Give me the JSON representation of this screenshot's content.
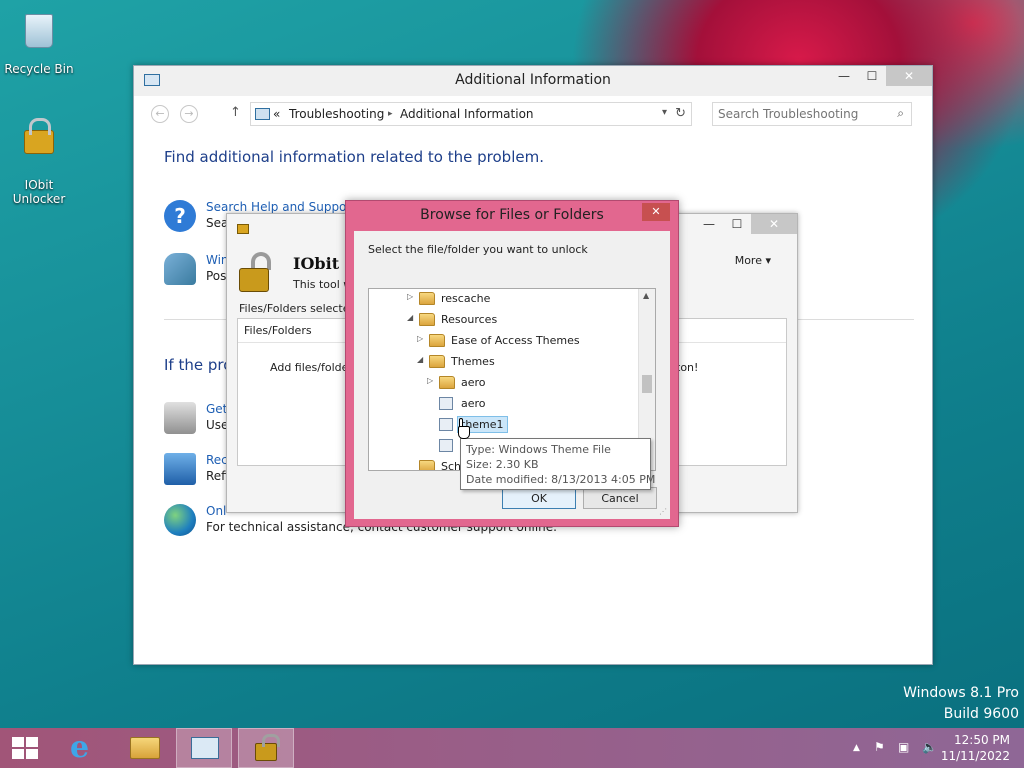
{
  "desktop": {
    "icons": [
      {
        "label": "Recycle Bin"
      },
      {
        "label_line1": "IObit",
        "label_line2": "Unlocker"
      }
    ],
    "watermark_line1": "Windows 8.1 Pro",
    "watermark_line2": "Build 9600"
  },
  "main_window": {
    "title": "Additional Information",
    "caption": {
      "minimize": "—",
      "maximize": "☐",
      "close": "✕"
    },
    "nav": {
      "back": "←",
      "forward": "→",
      "up": "↑"
    },
    "breadcrumb": {
      "prefix": "«",
      "item1": "Troubleshooting",
      "sep": "▸",
      "item2": "Additional Information"
    },
    "address_dropdown": "▾",
    "refresh": "↻",
    "search_placeholder": "Search Troubleshooting",
    "heading": "Find additional information related to the problem.",
    "options": [
      {
        "link": "Search Help and Support",
        "desc": "Sea"
      },
      {
        "link": "Win",
        "desc": "Pos"
      }
    ],
    "if_problem": "If the pro",
    "more_options": [
      {
        "link": "Get",
        "desc": "Use"
      },
      {
        "link": "Rec",
        "desc": "Refi"
      },
      {
        "link": "Onl",
        "desc": "For technical assistance, contact customer support online."
      }
    ]
  },
  "iobit_window": {
    "title": "IObit U",
    "tagline": "This tool wi",
    "more": "More ▾",
    "files_selected": "Files/Folders selected",
    "list_header": "Files/Folders",
    "list_hint": "Add files/folders",
    "list_hint_right": "ton!",
    "caption": {
      "minimize": "—",
      "maximize": "☐",
      "close": "✕"
    }
  },
  "browse_dialog": {
    "title": "Browse for Files or Folders",
    "close": "✕",
    "prompt": "Select the file/folder you want to unlock",
    "tree": [
      {
        "label": "rescache",
        "twist": "▷",
        "kind": "folder",
        "indent": 0
      },
      {
        "label": "Resources",
        "twist": "◢",
        "kind": "folder",
        "indent": 0
      },
      {
        "label": "Ease of Access Themes",
        "twist": "▷",
        "kind": "folder",
        "indent": 1
      },
      {
        "label": "Themes",
        "twist": "◢",
        "kind": "folder",
        "indent": 1
      },
      {
        "label": "aero",
        "twist": "▷",
        "kind": "folder",
        "indent": 2
      },
      {
        "label": "aero",
        "twist": "",
        "kind": "file",
        "indent": 2
      },
      {
        "label": "theme1",
        "twist": "",
        "kind": "file",
        "indent": 2,
        "selected": true
      },
      {
        "label": "",
        "twist": "",
        "kind": "file",
        "indent": 2
      },
      {
        "label": "Schi",
        "twist": "",
        "kind": "folder",
        "indent": 0
      }
    ],
    "ok": "OK",
    "cancel": "Cancel"
  },
  "tooltip": {
    "type": "Type: Windows Theme File",
    "size": "Size: 2.30 KB",
    "modified": "Date modified: 8/13/2013 4:05 PM"
  },
  "taskbar": {
    "time": "12:50 PM",
    "date": "11/11/2022",
    "tray_expand": "▲",
    "flag": "⚑",
    "network": "▣",
    "volume": "🔈"
  },
  "colors": {
    "dialog_accent": "#e2678f",
    "link": "#1e5fb4",
    "heading": "#1e3f8a",
    "close_red": "#c75050"
  }
}
